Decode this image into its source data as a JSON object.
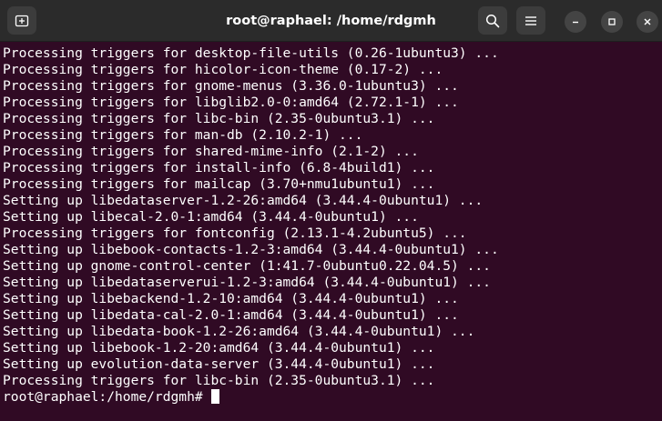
{
  "window": {
    "title": "root@raphael: /home/rdgmh"
  },
  "titlebar": {
    "icons": [
      "new-tab-icon",
      "search-icon",
      "hamburger-menu-icon",
      "minimize-icon",
      "maximize-icon",
      "close-icon"
    ]
  },
  "colors": {
    "terminal_bg": "#300a24",
    "titlebar_bg": "#2b2b2b",
    "text": "#ffffff"
  },
  "terminal": {
    "lines": [
      "Processing triggers for desktop-file-utils (0.26-1ubuntu3) ...",
      "Processing triggers for hicolor-icon-theme (0.17-2) ...",
      "Processing triggers for gnome-menus (3.36.0-1ubuntu3) ...",
      "Processing triggers for libglib2.0-0:amd64 (2.72.1-1) ...",
      "Processing triggers for libc-bin (2.35-0ubuntu3.1) ...",
      "Processing triggers for man-db (2.10.2-1) ...",
      "Processing triggers for shared-mime-info (2.1-2) ...",
      "Processing triggers for install-info (6.8-4build1) ...",
      "Processing triggers for mailcap (3.70+nmu1ubuntu1) ...",
      "Setting up libedataserver-1.2-26:amd64 (3.44.4-0ubuntu1) ...",
      "Setting up libecal-2.0-1:amd64 (3.44.4-0ubuntu1) ...",
      "Processing triggers for fontconfig (2.13.1-4.2ubuntu5) ...",
      "Setting up libebook-contacts-1.2-3:amd64 (3.44.4-0ubuntu1) ...",
      "Setting up gnome-control-center (1:41.7-0ubuntu0.22.04.5) ...",
      "Setting up libedataserverui-1.2-3:amd64 (3.44.4-0ubuntu1) ...",
      "Setting up libebackend-1.2-10:amd64 (3.44.4-0ubuntu1) ...",
      "Setting up libedata-cal-2.0-1:amd64 (3.44.4-0ubuntu1) ...",
      "Setting up libedata-book-1.2-26:amd64 (3.44.4-0ubuntu1) ...",
      "Setting up libebook-1.2-20:amd64 (3.44.4-0ubuntu1) ...",
      "Setting up evolution-data-server (3.44.4-0ubuntu1) ...",
      "Processing triggers for libc-bin (2.35-0ubuntu3.1) ..."
    ],
    "prompt": "root@raphael:/home/rdgmh# "
  }
}
